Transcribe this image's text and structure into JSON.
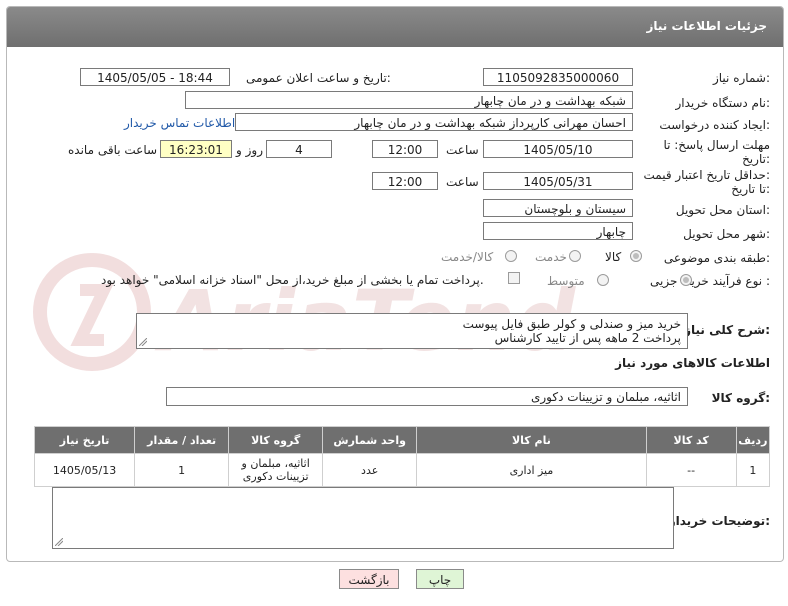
{
  "header": {
    "title": "جزئیات اطلاعات نیاز"
  },
  "fields": {
    "need_number_label": "شماره نیاز:",
    "need_number": "1105092835000060",
    "announce_label": "تاریخ و ساعت اعلان عمومی:",
    "announce_value": "1405/05/05 - 18:44",
    "buyer_org_label": "نام دستگاه خریدار:",
    "buyer_org": "شبکه بهداشت و در مان چابهار",
    "creator_label": "ایجاد کننده درخواست:",
    "creator": "احسان مهرانی کارپرداز شبکه بهداشت و در مان چابهار",
    "contact_link": "اطلاعات تماس خریدار",
    "deadline_label_1": "مهلت ارسال پاسخ: تا",
    "deadline_label_2": "تاریخ:",
    "deadline_date": "1405/05/10",
    "hour_label": "ساعت",
    "deadline_time": "12:00",
    "days_value": "4",
    "days_label": "روز و",
    "remaining_time": "16:23:01",
    "remaining_label": "ساعت باقی مانده",
    "price_label_1": "حداقل تاریخ اعتبار قیمت:",
    "price_label_2": "تا تاریخ:",
    "price_date": "1405/05/31",
    "price_time": "12:00",
    "province_label": "استان محل تحویل:",
    "province": "سیستان و بلوچستان",
    "city_label": "شهر محل تحویل:",
    "city": "چابهار",
    "category_label": "طبقه بندی موضوعی:",
    "category_options": [
      "کالا",
      "خدمت",
      "کالا/خدمت"
    ],
    "process_label": "نوع فرآیند خرید :",
    "process_options": [
      "جزیی",
      "متوسط"
    ],
    "payment_note": "پرداخت تمام یا بخشی از مبلغ خرید،از محل \"اسناد خزانه اسلامی\" خواهد بود.",
    "description_label": "شرح کلی نیاز:",
    "description_line1": "خرید میز و صندلی و کولر طبق فایل پیوست",
    "description_line2": "پرداخت 2 ماهه پس از تایید کارشناس",
    "goods_info_title": "اطلاعات کالاهای مورد نیاز",
    "goods_group_label": "گروه کالا:",
    "goods_group": "اثاثیه، مبلمان و تزیینات دکوری",
    "buyer_notes_label": "توضیحات خریدار:"
  },
  "table": {
    "headers": [
      "ردیف",
      "کد کالا",
      "نام کالا",
      "واحد شمارش",
      "گروه کالا",
      "تعداد / مقدار",
      "تاریخ نیاز"
    ],
    "rows": [
      {
        "row": "1",
        "code": "--",
        "name": "میز اداری",
        "unit": "عدد",
        "group": "اثاثیه، مبلمان و تزیینات دکوری",
        "qty": "1",
        "date": "1405/05/13"
      }
    ]
  },
  "buttons": {
    "print": "چاپ",
    "back": "بازگشت"
  },
  "watermark": "AriaTender.net",
  "colors": {
    "header_bg": "#6f6f6f",
    "link": "#2159a8",
    "yellow_field": "#ffffc4",
    "print_btn": "#dff5d6",
    "back_btn": "#fde0e0"
  }
}
